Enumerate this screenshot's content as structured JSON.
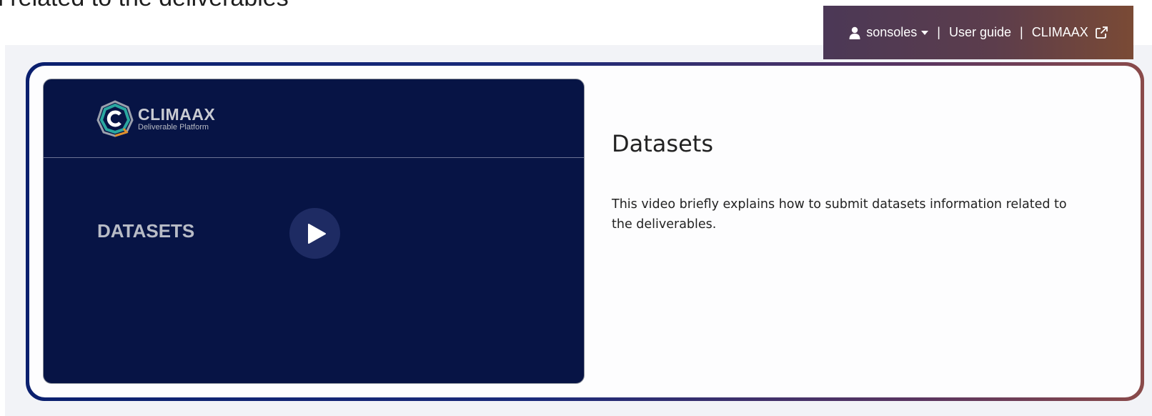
{
  "page": {
    "heading": "n related to the deliverables"
  },
  "user_bar": {
    "username": "sonsoles",
    "separator": "|",
    "user_guide": "User guide",
    "external_link": "CLIMAAX",
    "icons": {
      "user": "user-icon",
      "caret": "caret-down-icon",
      "external": "external-link-icon"
    }
  },
  "video": {
    "logo_brand": "CLIMAAX",
    "logo_subtitle": "Deliverable Platform",
    "title": "DATASETS",
    "play_icon": "play-icon"
  },
  "info": {
    "title": "Datasets",
    "description": "This video briefly explains how to submit datasets information related to the deliverables."
  },
  "colors": {
    "video_bg": "#071445",
    "user_bar_start": "#4b3856",
    "user_bar_end": "#7a4a35",
    "card_border_start": "#0a1f6e",
    "card_border_end": "#8a4a4a"
  }
}
